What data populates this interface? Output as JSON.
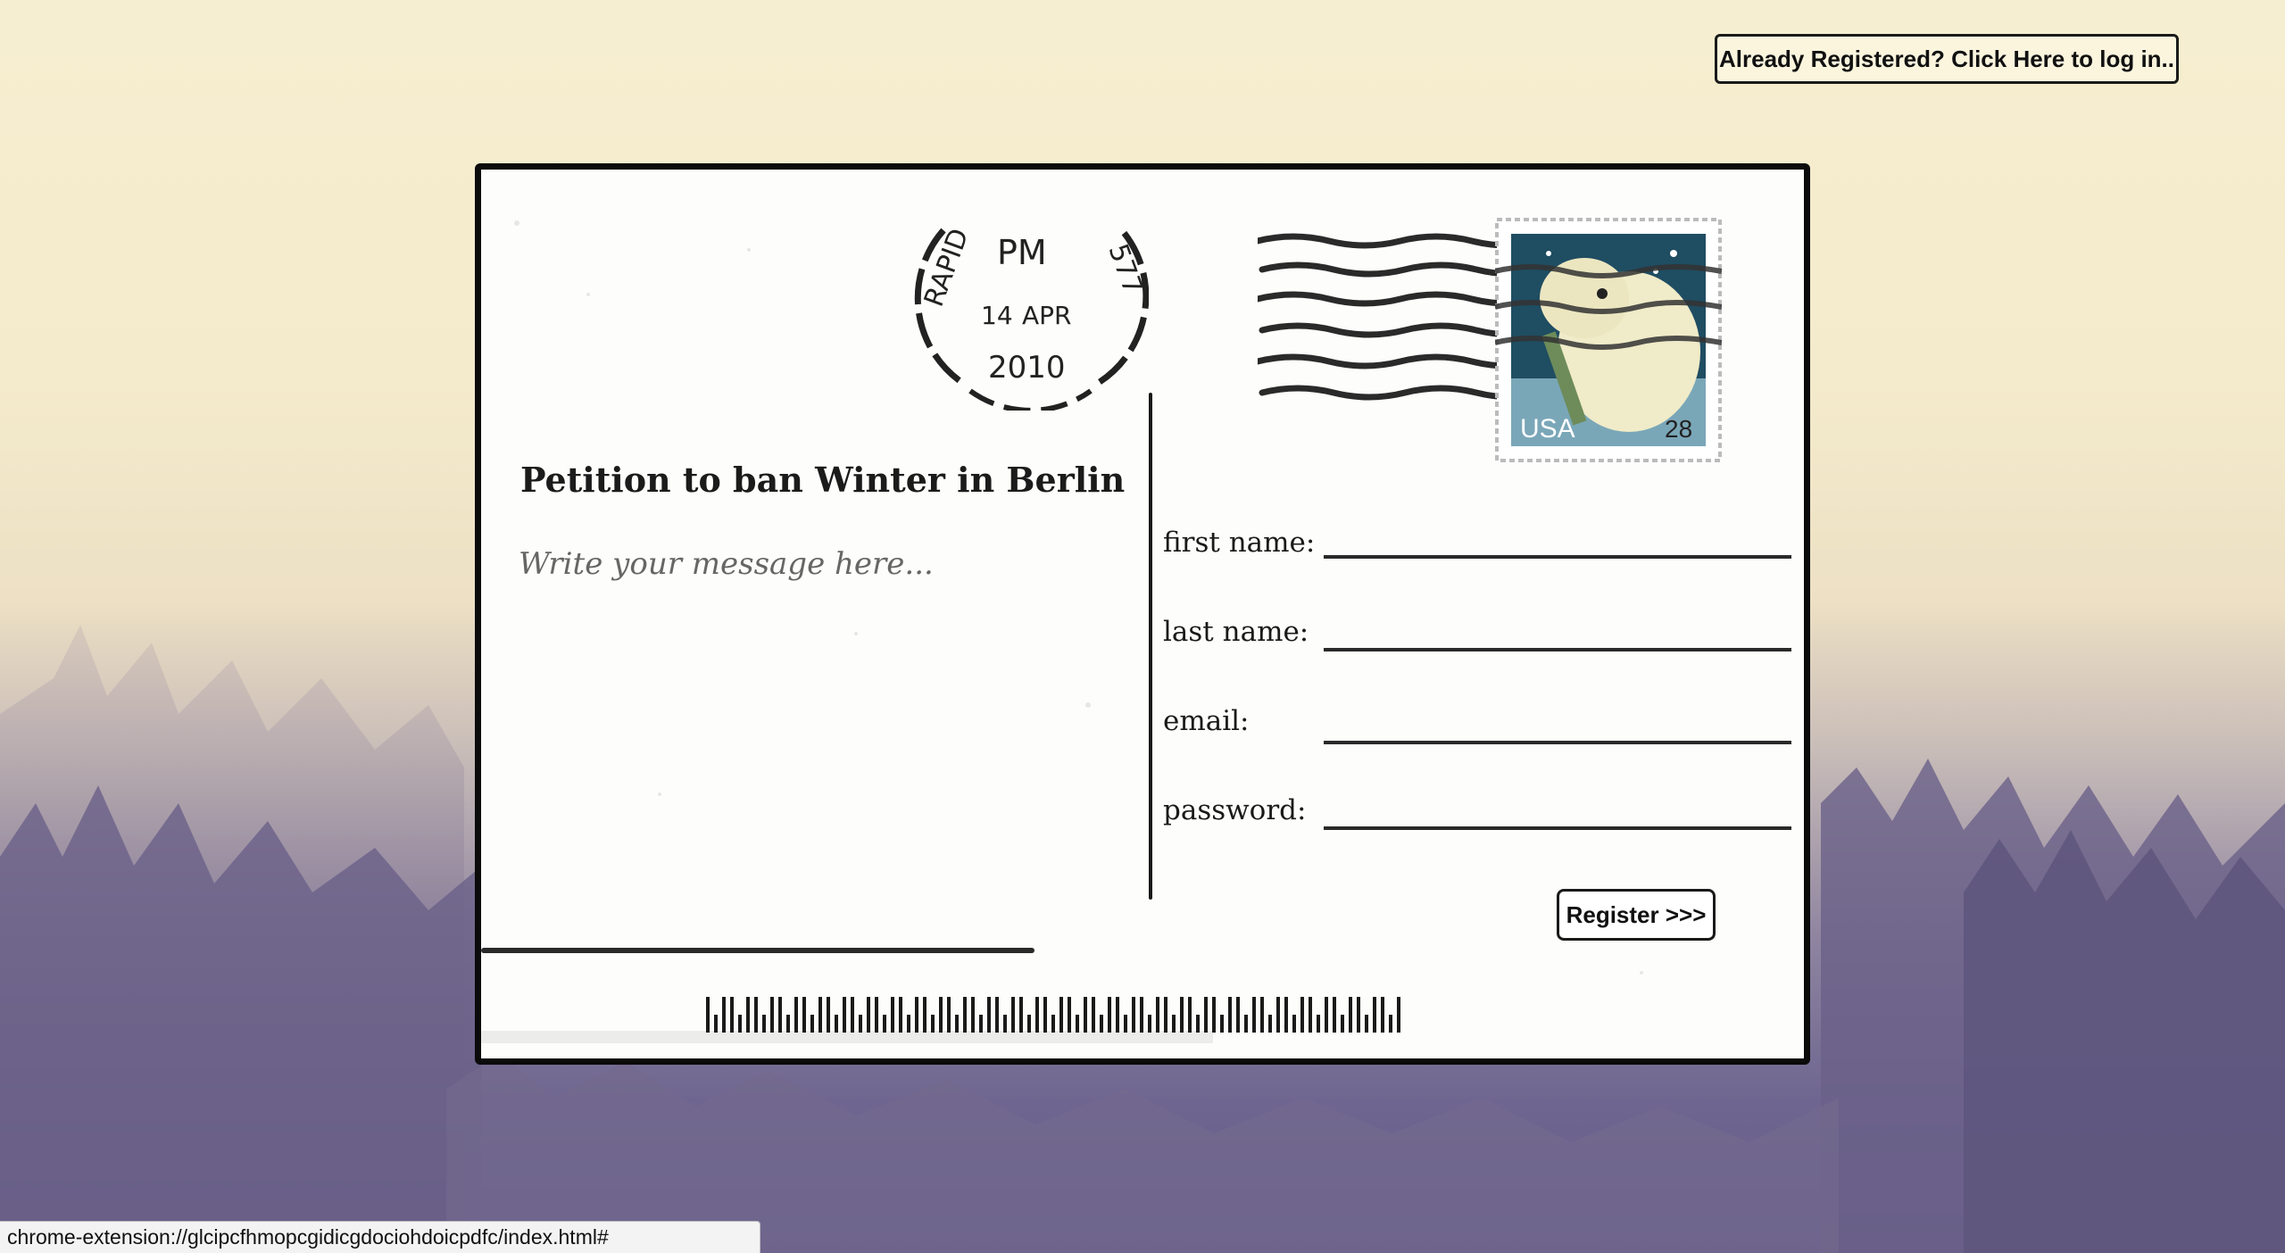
{
  "header": {
    "login_button_label": "Already Registered? Click Here to log in.."
  },
  "postcard": {
    "title": "Petition to ban Winter in Berlin",
    "message_placeholder": "Write your message here...",
    "postmark": {
      "top_text": "RAPID",
      "right_text": "577",
      "time": "PM",
      "day": "14",
      "month": "APR",
      "year": "2010"
    },
    "stamp": {
      "country": "USA",
      "value": "28",
      "icon": "polar-bear-stamp-icon"
    }
  },
  "form": {
    "fields": [
      {
        "label": "first name:",
        "value": ""
      },
      {
        "label": "last name:",
        "value": ""
      },
      {
        "label": "email:",
        "value": ""
      },
      {
        "label": "password:",
        "value": ""
      }
    ],
    "register_label": "Register >>>"
  },
  "status_bar": {
    "url": "chrome-extension://glcipcfhmopcgidicgdociohdoicpdfc/index.html#"
  },
  "colors": {
    "sky": "#f6eed0",
    "forest": "#6e6690",
    "card_border": "#0b0b0b",
    "ink": "#1a1a1a"
  }
}
